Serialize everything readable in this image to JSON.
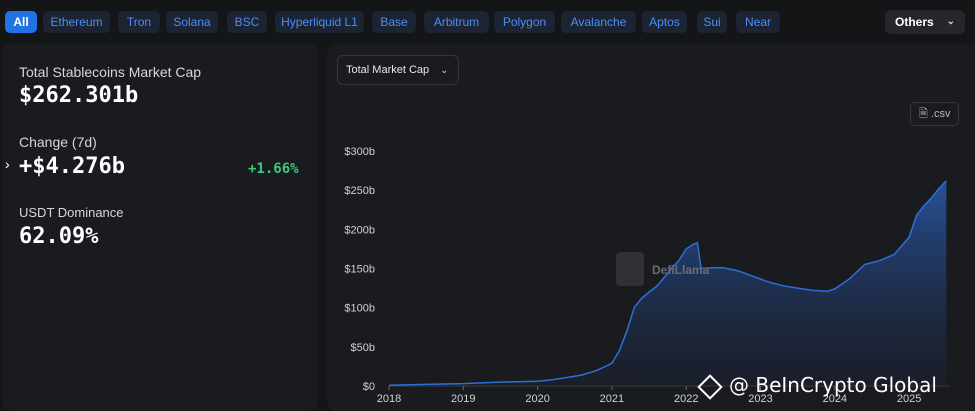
{
  "chains": [
    "All",
    "Ethereum",
    "Tron",
    "Solana",
    "BSC",
    "Hyperliquid L1",
    "Base",
    "Arbitrum",
    "Polygon",
    "Avalanche",
    "Aptos",
    "Sui",
    "Near"
  ],
  "others_label": "Others",
  "stats": {
    "total_label": "Total Stablecoins Market Cap",
    "total_value": "$262.301b",
    "change_label": "Change (7d)",
    "change_value": "+$4.276b",
    "change_pct": "+1.66%",
    "dominance_label": "USDT Dominance",
    "dominance_value": "62.09%"
  },
  "chart_controls": {
    "metric": "Total Market Cap",
    "csv": ".csv"
  },
  "chart_logo": "DefiLlama",
  "watermark": "@ BeInCrypto Global",
  "colors": {
    "accent": "#2172e5",
    "line": "#2c6fd6",
    "positive": "#3cc878"
  },
  "chart_data": {
    "type": "area",
    "ylabels": [
      "$300b",
      "$250b",
      "$200b",
      "$150b",
      "$100b",
      "$50b",
      "$0"
    ],
    "xlabels": [
      "2018",
      "2019",
      "2020",
      "2021",
      "2022",
      "2023",
      "2024",
      "2025"
    ],
    "ylim": [
      0,
      300
    ],
    "xlim": [
      2018,
      2025.55
    ],
    "x": [
      2018.0,
      2018.5,
      2019.0,
      2019.5,
      2020.0,
      2020.2,
      2020.4,
      2020.6,
      2020.8,
      2021.0,
      2021.1,
      2021.2,
      2021.3,
      2021.4,
      2021.5,
      2021.6,
      2021.7,
      2021.8,
      2021.9,
      2022.0,
      2022.1,
      2022.15,
      2022.2,
      2022.35,
      2022.5,
      2022.7,
      2022.9,
      2023.1,
      2023.3,
      2023.5,
      2023.7,
      2023.9,
      2024.0,
      2024.2,
      2024.4,
      2024.6,
      2024.8,
      2025.0,
      2025.1,
      2025.2,
      2025.3,
      2025.4,
      2025.5
    ],
    "values": [
      1,
      2,
      3,
      5,
      6,
      8,
      11,
      14,
      20,
      29,
      45,
      70,
      100,
      112,
      120,
      127,
      138,
      150,
      160,
      175,
      181,
      183,
      150,
      151,
      151,
      147,
      140,
      133,
      128,
      125,
      122,
      121,
      124,
      137,
      155,
      160,
      168,
      190,
      218,
      230,
      240,
      252,
      262
    ]
  }
}
